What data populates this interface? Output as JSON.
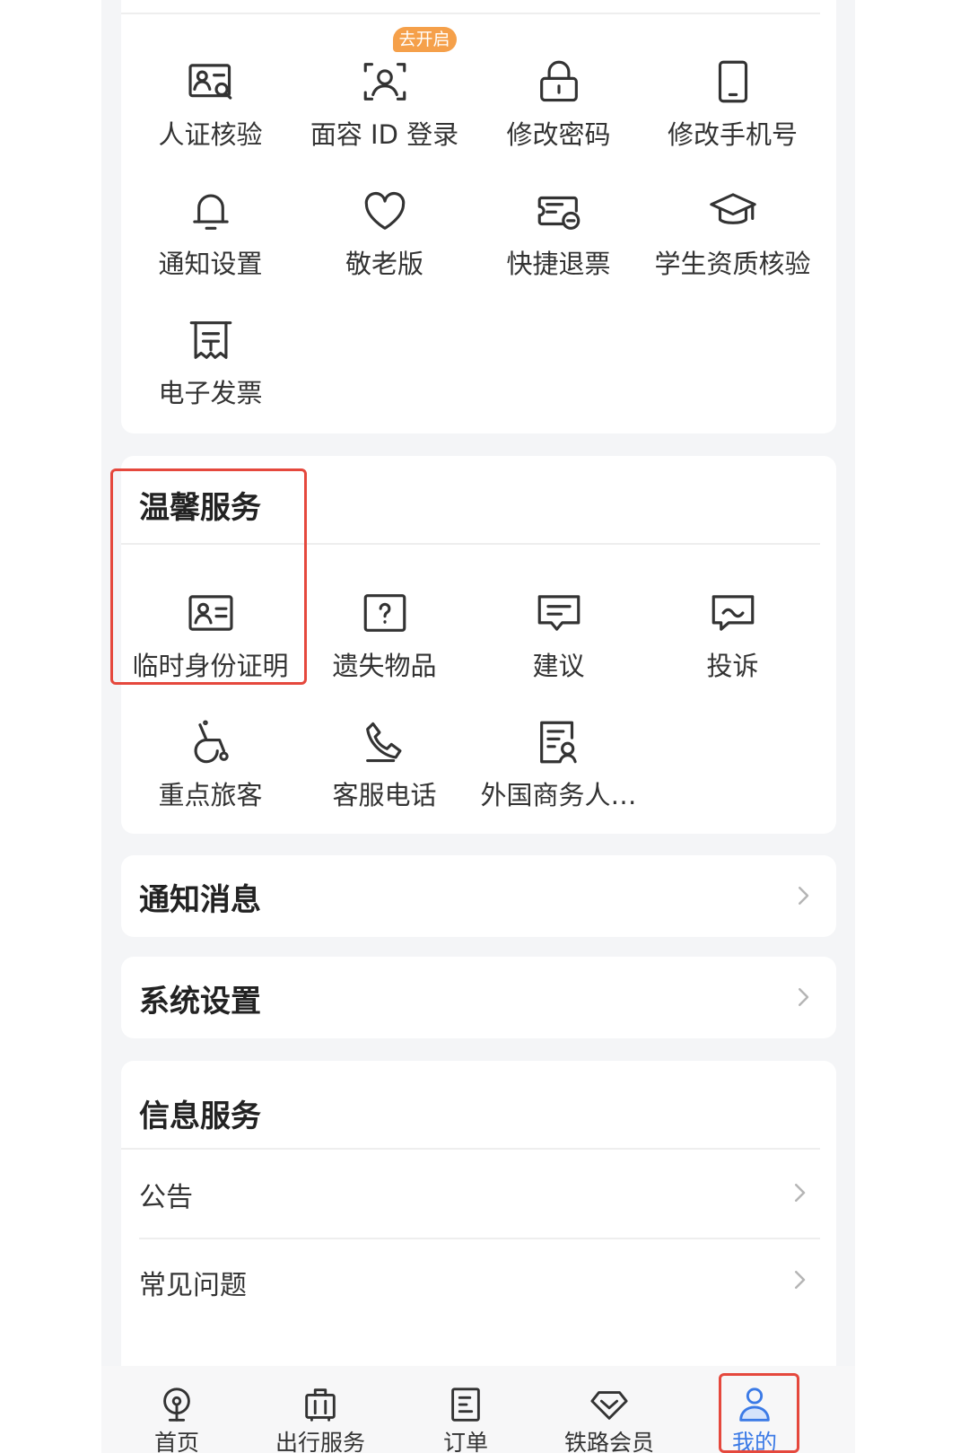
{
  "account": {
    "items": [
      {
        "label": "人证核验",
        "icon": "id-verify-icon"
      },
      {
        "label": "面容 ID 登录",
        "icon": "face-id-icon",
        "badge": "去开启"
      },
      {
        "label": "修改密码",
        "icon": "lock-icon"
      },
      {
        "label": "修改手机号",
        "icon": "phone-icon"
      },
      {
        "label": "通知设置",
        "icon": "bell-icon"
      },
      {
        "label": "敬老版",
        "icon": "heart-icon"
      },
      {
        "label": "快捷退票",
        "icon": "ticket-refund-icon"
      },
      {
        "label": "学生资质核验",
        "icon": "graduation-cap-icon"
      },
      {
        "label": "电子发票",
        "icon": "invoice-icon"
      }
    ]
  },
  "warm_services": {
    "title": "温馨服务",
    "items": [
      {
        "label": "临时身份证明",
        "icon": "id-card-icon"
      },
      {
        "label": "遗失物品",
        "icon": "question-box-icon"
      },
      {
        "label": "建议",
        "icon": "suggestion-bubble-icon"
      },
      {
        "label": "投诉",
        "icon": "complaint-bubble-icon"
      },
      {
        "label": "重点旅客",
        "icon": "wheelchair-icon"
      },
      {
        "label": "客服电话",
        "icon": "customer-phone-icon"
      },
      {
        "label": "外国商务人…",
        "icon": "foreign-business-doc-icon"
      }
    ]
  },
  "notice_row": {
    "label": "通知消息"
  },
  "settings_row": {
    "label": "系统设置"
  },
  "info_services": {
    "title": "信息服务",
    "rows": [
      {
        "label": "公告"
      },
      {
        "label": "常见问题"
      }
    ]
  },
  "tabbar": {
    "tabs": [
      {
        "label": "首页",
        "icon": "home-icon"
      },
      {
        "label": "出行服务",
        "icon": "luggage-icon"
      },
      {
        "label": "订单",
        "icon": "order-icon"
      },
      {
        "label": "铁路会员",
        "icon": "member-diamond-icon"
      },
      {
        "label": "我的",
        "icon": "user-icon",
        "active": true
      }
    ]
  },
  "colors": {
    "accent": "#3b7ae6",
    "badge": "#f5a04a",
    "highlight": "#e5483d",
    "background": "#f4f5f7"
  }
}
